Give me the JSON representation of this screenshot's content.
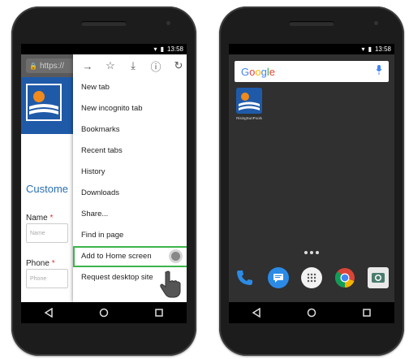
{
  "left_phone": {
    "status_time": "13:58",
    "url_text": "https://",
    "site": {
      "heading": "Custome",
      "name_label": "Name",
      "name_placeholder": "Name",
      "phone_label": "Phone",
      "phone_placeholder": "Phone",
      "required_mark": "*"
    },
    "menu_items": [
      "New tab",
      "New incognito tab",
      "Bookmarks",
      "Recent tabs",
      "History",
      "Downloads",
      "Share...",
      "Find in page",
      "Add to Home screen",
      "Request desktop site"
    ],
    "highlight_color": "#3cb44a"
  },
  "right_phone": {
    "status_time": "13:58",
    "search_brand": [
      "G",
      "o",
      "o",
      "g",
      "l",
      "e"
    ],
    "brand_colors": [
      "#4285F4",
      "#EA4335",
      "#FBBC05",
      "#4285F4",
      "#34A853",
      "#EA4335"
    ],
    "app_label": "RisingSunPools",
    "dock_icons": [
      "phone-icon",
      "messages-icon",
      "apps-icon",
      "chrome-icon",
      "camera-icon"
    ]
  },
  "site_brand_color": "#1f5aa8"
}
